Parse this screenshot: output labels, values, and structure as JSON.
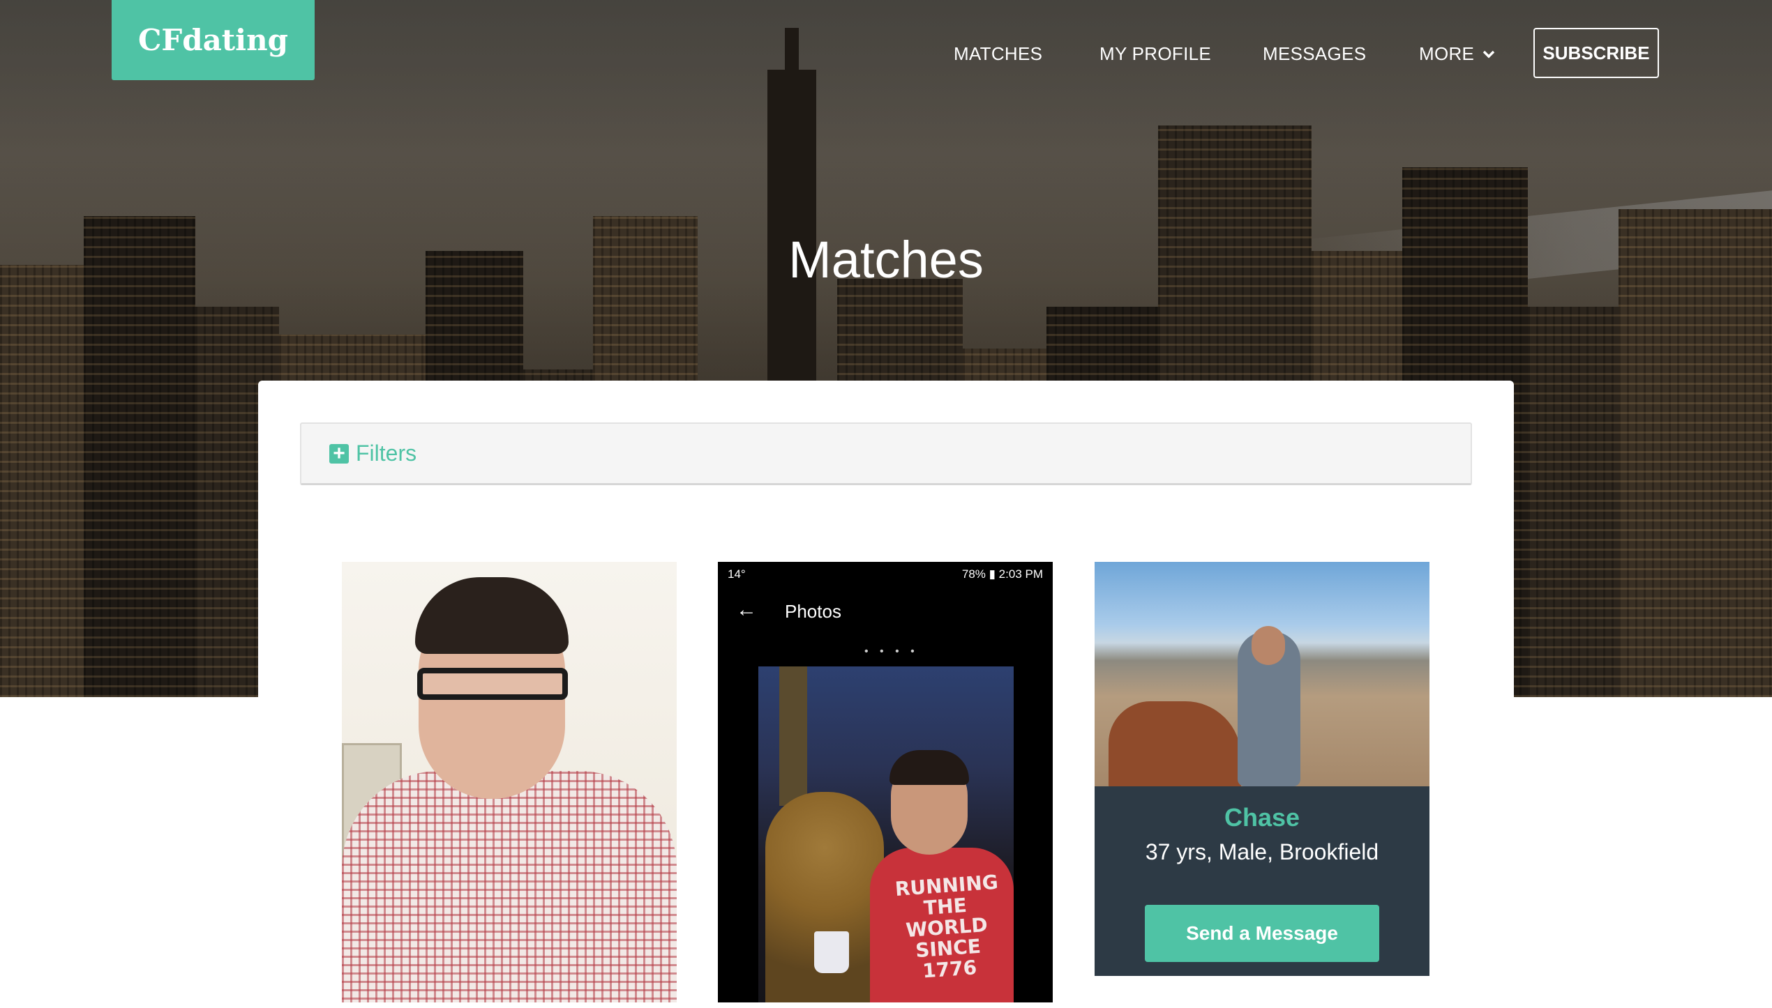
{
  "brand": {
    "logo_text": "CFdating",
    "accent": "#4fc3a5"
  },
  "nav": {
    "items": [
      "MATCHES",
      "MY PROFILE",
      "MESSAGES",
      "MORE"
    ],
    "more_icon": "chevron-down-icon",
    "subscribe_label": "SUBSCRIBE"
  },
  "page": {
    "title": "Matches"
  },
  "filters": {
    "icon": "plus-square-icon",
    "label": "Filters"
  },
  "cards": [
    {
      "type": "photo"
    },
    {
      "type": "photo",
      "phone_status_left": "14°",
      "phone_status_right": "78% ▮ 2:03 PM",
      "phone_title": "Photos",
      "shirt_text": "RUNNING THE WORLD SINCE 1776"
    },
    {
      "type": "profile",
      "name": "Chase",
      "details": "37 yrs, Male, Brookfield",
      "button_label": "Send a Message"
    }
  ]
}
